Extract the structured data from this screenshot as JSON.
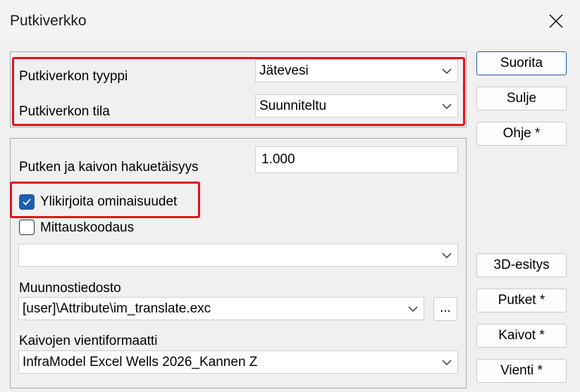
{
  "window": {
    "title": "Putkiverkko"
  },
  "network": {
    "type_label": "Putkiverkon tyyppi",
    "type_value": "Jätevesi",
    "state_label": "Putkiverkon tila",
    "state_value": "Suunniteltu"
  },
  "options": {
    "search_distance_label": "Putken ja kaivon hakuetäisyys",
    "search_distance_value": "1.000",
    "overwrite_label": "Ylikirjoita ominaisuudet",
    "overwrite_checked": true,
    "measure_coding_label": "Mittauskoodaus",
    "measure_coding_checked": false,
    "measure_coding_value": "",
    "translation_file_label": "Muunnostiedosto",
    "translation_file_value": "[user]\\Attribute\\im_translate.exc",
    "browse_label": "...",
    "export_format_label": "Kaivojen vientiformaatti",
    "export_format_value": "InfraModel Excel Wells 2026_Kannen Z"
  },
  "buttons": {
    "run": "Suorita",
    "close": "Sulje",
    "help": "Ohje *",
    "view3d": "3D-esitys",
    "pipes": "Putket *",
    "wells": "Kaivot *",
    "export": "Vienti *"
  },
  "colors": {
    "highlight": "#e0121d",
    "checkbox_checked": "#1c5fb0",
    "default_button_border": "#1f5fa8"
  }
}
